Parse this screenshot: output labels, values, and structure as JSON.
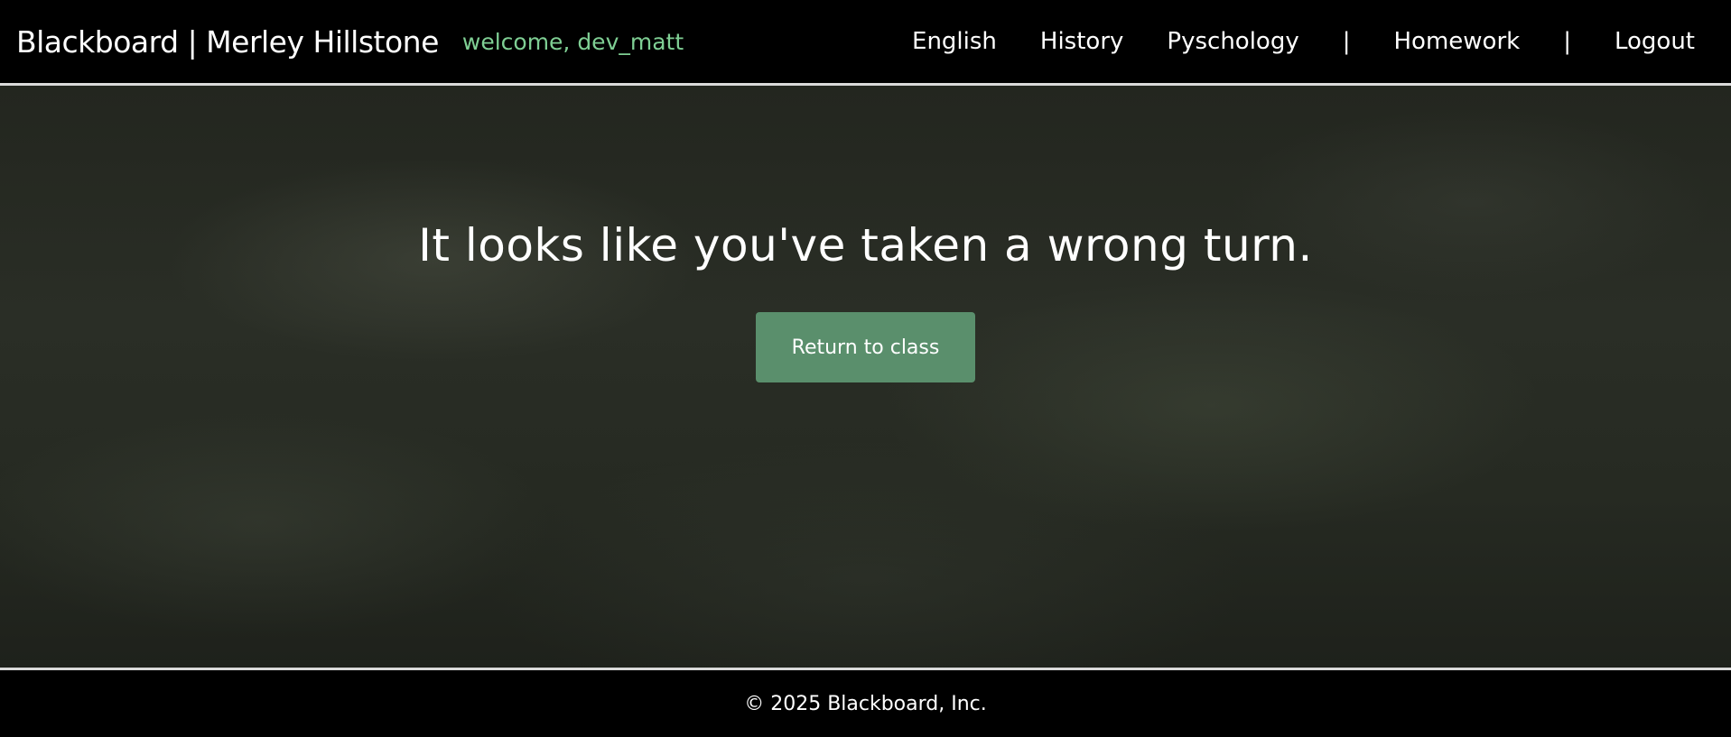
{
  "header": {
    "brand": "Blackboard | Merley Hillstone",
    "welcome": "welcome, dev_matt",
    "nav": {
      "english": "English",
      "history": "History",
      "psychology": "Pyschology",
      "separator": "|",
      "homework": "Homework",
      "logout": "Logout"
    }
  },
  "main": {
    "headline": "It looks like you've taken a wrong turn.",
    "return_button_label": "Return to class"
  },
  "footer": {
    "copyright": "© 2025 Blackboard, Inc."
  },
  "colors": {
    "accent_green": "#5a8f6c",
    "welcome_green": "#7fcf94",
    "header_bg": "#000000",
    "board_bg": "#262a22"
  }
}
